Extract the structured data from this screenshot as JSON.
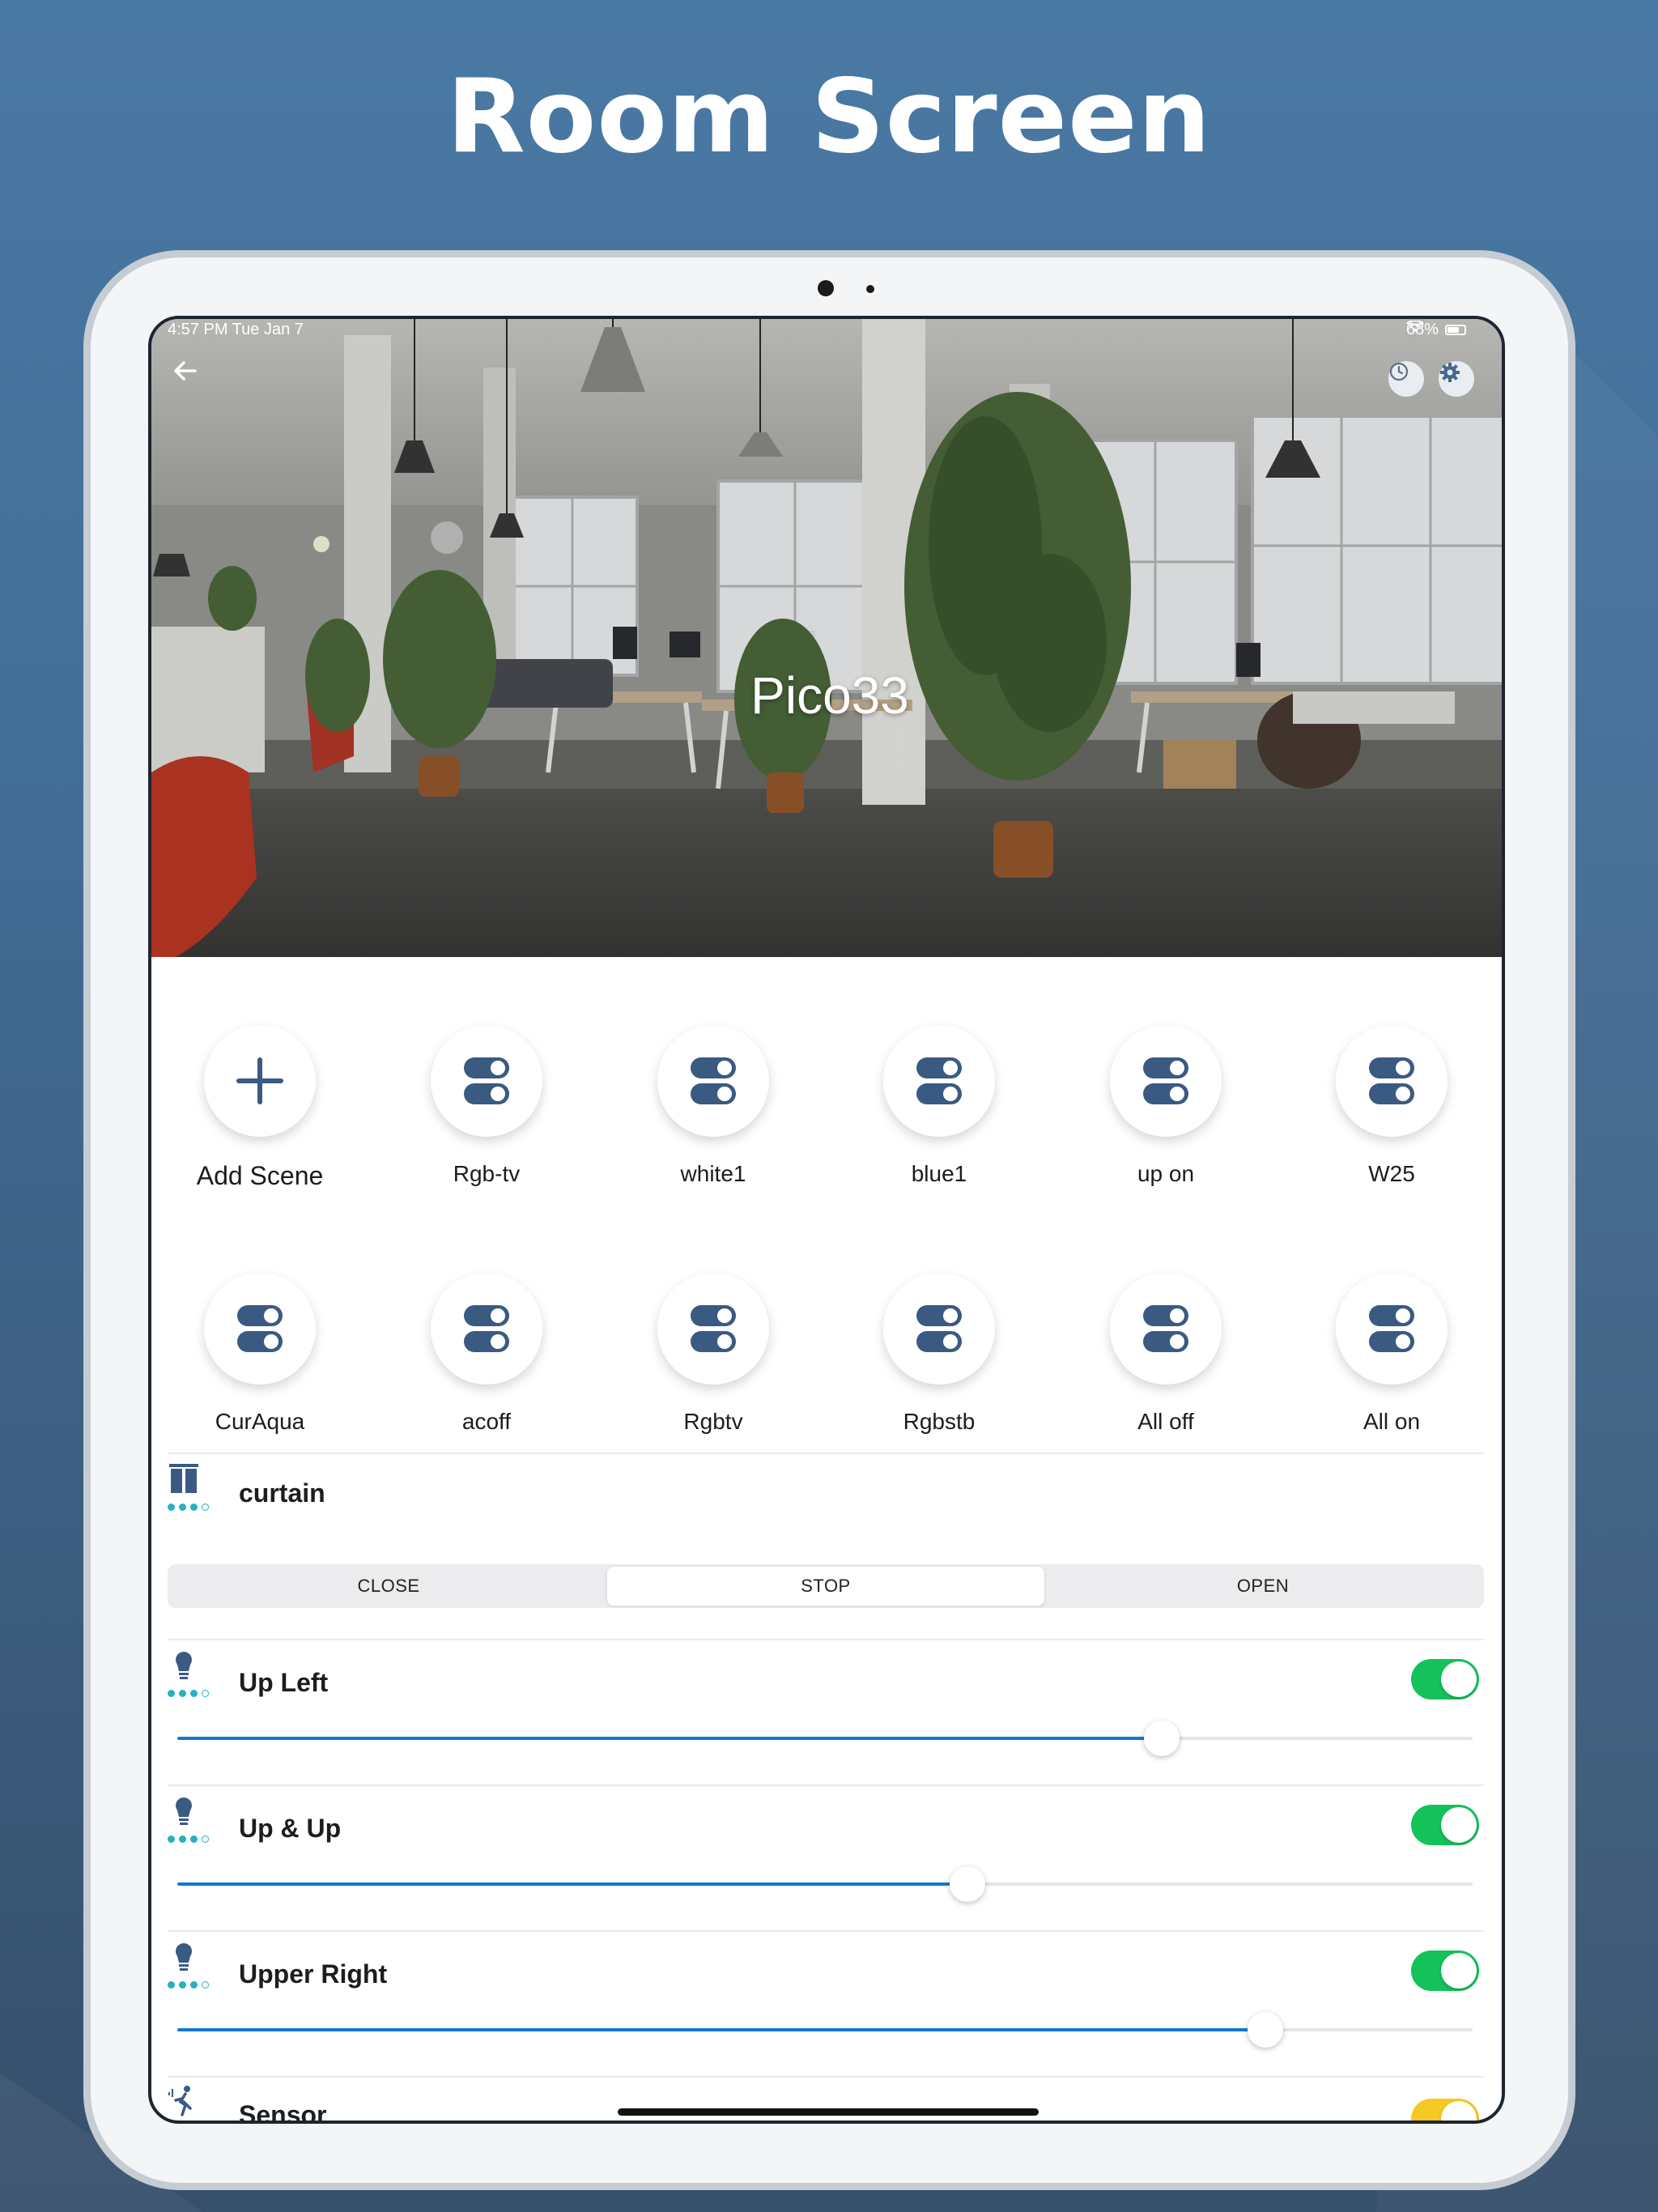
{
  "promo": {
    "title": "Room Screen"
  },
  "status_bar": {
    "time": "4:57 PM   Tue Jan 7",
    "battery": "68%"
  },
  "header": {
    "back_icon": "arrow-left-icon",
    "room_name": "Pico33",
    "history_icon": "clock-icon",
    "settings_icon": "gear-icon"
  },
  "scenes": [
    {
      "label": "Add Scene",
      "icon": "plus-icon"
    },
    {
      "label": "Rgb-tv",
      "icon": "toggle-scene-icon"
    },
    {
      "label": "white1",
      "icon": "toggle-scene-icon"
    },
    {
      "label": "blue1",
      "icon": "toggle-scene-icon"
    },
    {
      "label": "up on",
      "icon": "toggle-scene-icon"
    },
    {
      "label": "W25",
      "icon": "toggle-scene-icon"
    },
    {
      "label": "CurAqua",
      "icon": "toggle-scene-icon"
    },
    {
      "label": "acoff",
      "icon": "toggle-scene-icon"
    },
    {
      "label": "Rgbtv",
      "icon": "toggle-scene-icon"
    },
    {
      "label": "Rgbstb",
      "icon": "toggle-scene-icon"
    },
    {
      "label": "All off",
      "icon": "toggle-scene-icon"
    },
    {
      "label": "All on",
      "icon": "toggle-scene-icon"
    }
  ],
  "curtain": {
    "name": "curtain",
    "icon": "curtain-icon",
    "buttons": [
      "CLOSE",
      "STOP",
      "OPEN"
    ],
    "selected": "STOP"
  },
  "devices": [
    {
      "name": "Up Left",
      "icon": "bulb-icon",
      "on": true,
      "level_percent": 76
    },
    {
      "name": "Up & Up",
      "icon": "bulb-icon",
      "on": true,
      "level_percent": 61
    },
    {
      "name": "Upper Right",
      "icon": "bulb-icon",
      "on": true,
      "level_percent": 84
    },
    {
      "name": "Sensor",
      "icon": "motion-sensor-icon",
      "on": true,
      "toggle_color": "#f4c921"
    }
  ],
  "colors": {
    "accent": "#1378d6",
    "toggle_on": "#14c25a",
    "icon_navy": "#3a5a82",
    "dots": "#26b0c4"
  }
}
